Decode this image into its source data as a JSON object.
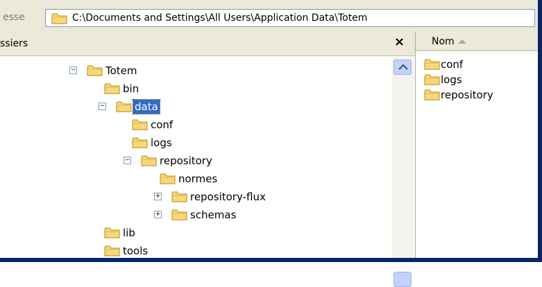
{
  "address_bar": {
    "label": "esse",
    "path": "C:\\Documents and Settings\\All Users\\Application Data\\Totem"
  },
  "tree": {
    "header_label": "ssiers",
    "close_symbol": "×",
    "nodes": [
      {
        "label": "Totem",
        "toggle": "−"
      },
      {
        "label": "bin"
      },
      {
        "label": "data",
        "toggle": "−",
        "selected": true
      },
      {
        "label": "conf"
      },
      {
        "label": "logs"
      },
      {
        "label": "repository",
        "toggle": "−"
      },
      {
        "label": "normes"
      },
      {
        "label": "repository-flux",
        "toggle": "+"
      },
      {
        "label": "schemas",
        "toggle": "+"
      },
      {
        "label": "lib"
      },
      {
        "label": "tools"
      }
    ]
  },
  "list": {
    "column_header": "Nom",
    "sort_direction": "ascending",
    "items": [
      "conf",
      "logs",
      "repository"
    ]
  },
  "colors": {
    "selection": "#316ac5",
    "folder_fill": "#f5d87a",
    "folder_stroke": "#c79a2e",
    "frame": "#0a246a"
  },
  "icons": {
    "folder": "folder-icon",
    "scroll_up": "scroll-up-arrow-icon",
    "sort": "sort-ascending-icon",
    "close": "close-icon"
  }
}
